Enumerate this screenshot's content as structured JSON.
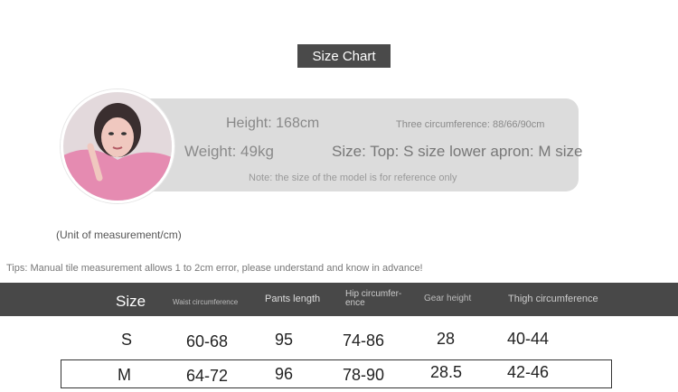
{
  "title": "Size Chart",
  "model": {
    "height": "Height: 168cm",
    "weight": "Weight: 49kg",
    "three_circumference": "Three circumference: 88/66/90cm",
    "size": "Size: Top: S size lower apron: M size",
    "note": "Note: the size of the model is for reference only"
  },
  "unit": "(Unit of measurement/cm)",
  "tips": "Tips: Manual tile measurement allows 1 to 2cm error, please understand and know in advance!",
  "table": {
    "headers": [
      "Size",
      "Waist circumference",
      "Pants length",
      "Hip circumfer-ence",
      "Gear height",
      "Thigh circumference"
    ],
    "rows": [
      [
        "S",
        "60-68",
        "95",
        "74-86",
        "28",
        "40-44"
      ],
      [
        "M",
        "64-72",
        "96",
        "78-90",
        "28.5",
        "42-46"
      ]
    ]
  }
}
